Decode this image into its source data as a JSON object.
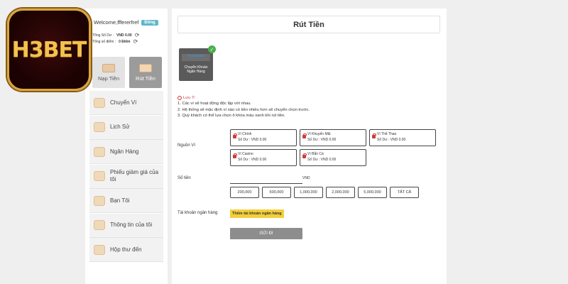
{
  "logo": {
    "text": "H3BET"
  },
  "sidebar": {
    "welcome": "Welcome,fffererfref",
    "badge": "Đồng",
    "balance_label": "Tổng Số Dư :",
    "balance_value": "VND 0.00",
    "points_label": "Tổng số điểm :",
    "points_value": "0 Điểm",
    "tabs": [
      {
        "label": "Nạp Tiền",
        "icon": "deposit-icon"
      },
      {
        "label": "Rút Tiền",
        "icon": "withdraw-icon"
      }
    ],
    "menu": [
      {
        "label": "Chuyển Ví",
        "icon": "wallet-transfer-icon"
      },
      {
        "label": "Lịch Sử",
        "icon": "history-icon"
      },
      {
        "label": "Ngân Hàng",
        "icon": "bank-icon"
      },
      {
        "label": "Phiếu giảm giá của tôi",
        "icon": "coupon-icon"
      },
      {
        "label": "Bạn Tôi",
        "icon": "friends-icon"
      },
      {
        "label": "Thông tin của tôi",
        "icon": "profile-icon"
      },
      {
        "label": "Hộp thư đến",
        "icon": "inbox-icon"
      }
    ]
  },
  "main": {
    "title": "Rút Tiền",
    "method": {
      "logo": "TRANSFER",
      "label": "Chuyển Khoản Ngân Hàng"
    },
    "notice": {
      "title": "Lưu Ý:",
      "lines": [
        "1. Các ví sẽ hoạt động độc lập với nhau.",
        "2. Hệ thống sẽ mặc định ví nào có tiền nhiều hơn sẽ chuyển chọn trước.",
        "3. Quý khách có thể lựa chọn ô khóa màu xanh khi rút tiền."
      ]
    },
    "source_label": "Nguồn Ví",
    "wallets": [
      {
        "name": "Ví Chính",
        "balance": "Số Dư : VND 0.00"
      },
      {
        "name": "Ví Khuyến Mãi",
        "balance": "Số Dư : VND 0.00"
      },
      {
        "name": "Ví Thể Thao",
        "balance": "Số Dư : VND 0.00"
      },
      {
        "name": "Ví Casino",
        "balance": "Số Dư : VND 0.00"
      },
      {
        "name": "Ví Bắn Cá",
        "balance": "Số Dư : VND 0.00"
      }
    ],
    "amount_label": "Số tiền",
    "amount_value": "",
    "currency": "VND",
    "amounts": [
      "200,000",
      "500,000",
      "1,000,000",
      "2,000,000",
      "5,000,000",
      "TẤT CẢ"
    ],
    "bank_label": "Tài khoản ngân hàng",
    "add_bank": "Thêm tài khoản ngân hàng",
    "submit": "GỬI ĐI"
  }
}
